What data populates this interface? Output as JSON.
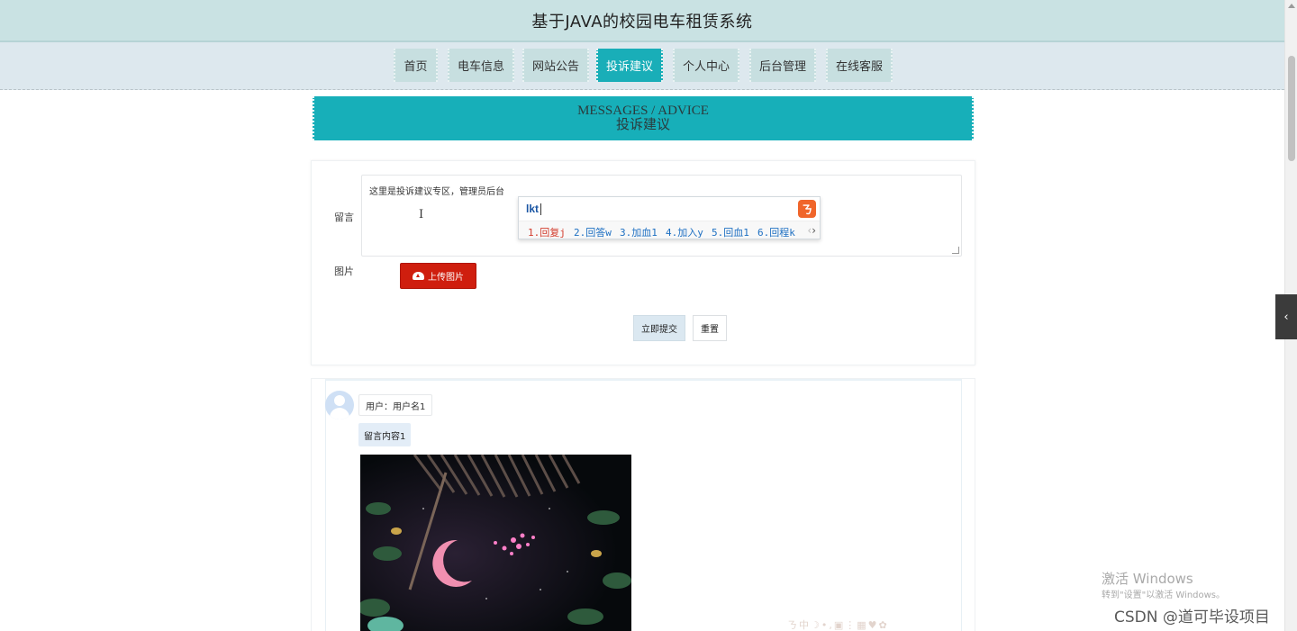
{
  "header": {
    "title": "基于JAVA的校园电车租赁系统"
  },
  "nav": {
    "items": [
      {
        "label": "首页"
      },
      {
        "label": "电车信息"
      },
      {
        "label": "网站公告"
      },
      {
        "label": "投诉建议"
      },
      {
        "label": "个人中心"
      },
      {
        "label": "后台管理"
      },
      {
        "label": "在线客服"
      }
    ],
    "active": "投诉建议"
  },
  "banner": {
    "english": "MESSAGES / ADVICE",
    "chinese": "投诉建议"
  },
  "form": {
    "message_label": "留言",
    "message_value": "这里是投诉建议专区，管理员后台",
    "image_label": "图片",
    "upload_label": "上传图片",
    "submit_label": "立即提交",
    "reset_label": "重置"
  },
  "ime": {
    "typed": "lkt",
    "candidates": [
      "1.回复j",
      "2.回答w",
      "3.加血1",
      "4.加入y",
      "5.回血1",
      "6.回程k"
    ]
  },
  "message": {
    "user": "用户：用户名1",
    "content": "留言内容1"
  },
  "icons": {
    "ime_logo": "sogou-ime-icon",
    "upload": "cloud-upload-icon",
    "avatar": "user-avatar-icon"
  },
  "colors": {
    "topbar": "#c9e2e3",
    "nav_active": "#19aeb8",
    "banner": "#17afb9",
    "upload_button": "#cf1e0e"
  },
  "watermark": {
    "line1": "激活 Windows",
    "line2": "转到\"设置\"以激活 Windows。",
    "csdn": "CSDN @道可毕设项目"
  }
}
